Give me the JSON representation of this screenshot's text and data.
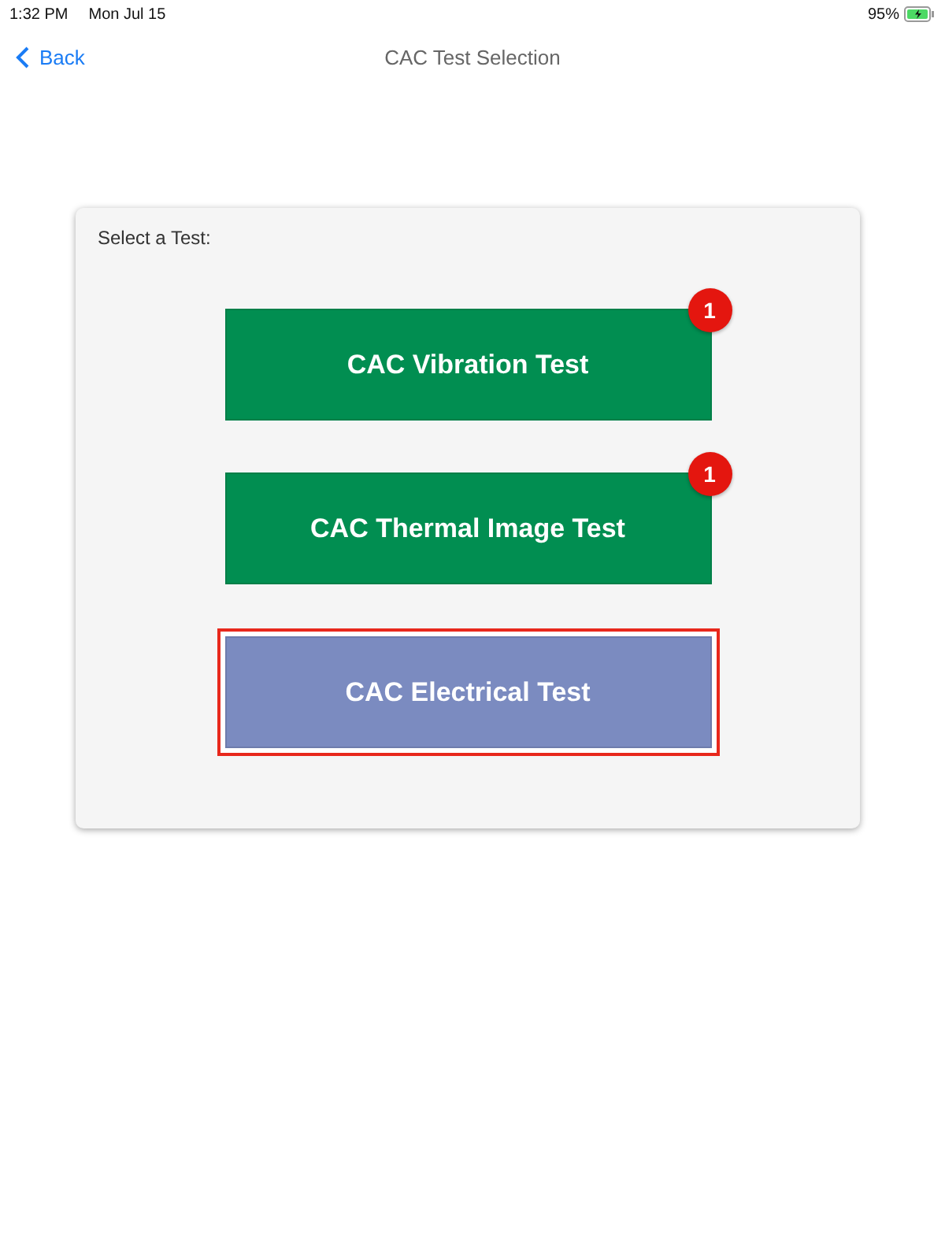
{
  "status_bar": {
    "time": "1:32 PM",
    "date": "Mon Jul 15",
    "battery": "95%"
  },
  "nav": {
    "back": "Back",
    "title": "CAC Test Selection"
  },
  "panel": {
    "label": "Select a Test:",
    "tests": [
      {
        "label": "CAC Vibration Test",
        "color": "#018e51",
        "badge": "1",
        "selected": false
      },
      {
        "label": "CAC Thermal Image Test",
        "color": "#018e51",
        "badge": "1",
        "selected": false
      },
      {
        "label": "CAC Electrical Test",
        "color": "#7b8bc0",
        "selected": true
      }
    ]
  }
}
